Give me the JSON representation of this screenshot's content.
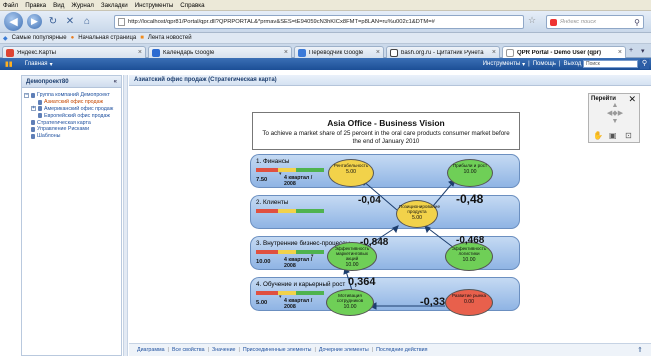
{
  "browser": {
    "menu": [
      "Файл",
      "Правка",
      "Вид",
      "Журнал",
      "Закладки",
      "Инструменты",
      "Справка"
    ],
    "url": "http://localhost/qpr81/Portal/qpr.dll?QPRPORTAL&*prmav&SES=tE94059cN3hKICx8FMT=p8LAN=ru%u002c1&DTM=#",
    "search_placeholder": "Яндекс поиск",
    "bookmarks": [
      "Самые популярные",
      "Начальная страница",
      "Лента новостей"
    ],
    "tabs": [
      {
        "label": "Яндекс.Карты",
        "color": "#d43"
      },
      {
        "label": "Календарь Google",
        "color": "#2c6bd1"
      },
      {
        "label": "Переводчик Google",
        "color": "#3b7ad8"
      },
      {
        "label": "bash.org.ru - Цитатник Рунета",
        "color": "#444"
      },
      {
        "label": "QPR Portal - Demo User (qpr)",
        "color": "#ccc"
      }
    ]
  },
  "app": {
    "home": "Главная",
    "tools": "Инструменты",
    "help": "Помощь",
    "logout": "Выход",
    "search": "Поиск"
  },
  "left_panel": {
    "title": "Демопроект80",
    "tree": [
      {
        "label": "Группа компаний Демопроект",
        "level": 0,
        "selected": false
      },
      {
        "label": "Азиатский офис продаж",
        "level": 2,
        "selected": true
      },
      {
        "label": "Американский офис продаж",
        "level": 1,
        "selected": false
      },
      {
        "label": "Европейский офис продаж",
        "level": 2,
        "selected": false
      },
      {
        "label": "Стратегическая карта",
        "level": 0,
        "selected": false
      },
      {
        "label": "Управление Рисками",
        "level": 0,
        "selected": false
      },
      {
        "label": "Шаблоны",
        "level": 0,
        "selected": false
      }
    ]
  },
  "main": {
    "title": "Азиатский офис продаж (Стратегическая карта)",
    "vision_title": "Asia Office - Business Vision",
    "vision_text": "To achieve a market share of 25 percent in the oral care products consumer market before the end of January 2010",
    "perspectives": [
      {
        "name": "1. Финансы",
        "value": "7.50",
        "period": "4 квартал / 2008"
      },
      {
        "name": "2. Клиенты",
        "value": "",
        "period": ""
      },
      {
        "name": "3. Внутренние бизнес-процессы",
        "value": "10.00",
        "period": "4 квартал / 2008"
      },
      {
        "name": "4. Обучение и карьерный рост",
        "value": "5.00",
        "period": "4 квартал / 2008"
      }
    ],
    "objectives": [
      {
        "name": "Рентабельность",
        "value": "5.00",
        "color": "#f2d24a"
      },
      {
        "name": "Прибыли и рост",
        "value": "10.00",
        "color": "#6fcf57"
      },
      {
        "name": "Позиционирование продукта",
        "value": "5.00",
        "color": "#f2d24a"
      },
      {
        "name": "Эффективность маркетинговых акций",
        "value": "10.00",
        "color": "#6fcf57"
      },
      {
        "name": "Эффективность логистики",
        "value": "10.00",
        "color": "#6fcf57"
      },
      {
        "name": "Мотивация сотрудников",
        "value": "10.00",
        "color": "#6fcf57"
      },
      {
        "name": "Развитие рынка",
        "value": "0.00",
        "color": "#e8604c"
      }
    ],
    "coefficients": [
      "-0,04",
      "-0,48",
      "-0,848",
      "-0,468",
      "0,364",
      "-0,33"
    ],
    "go_panel": {
      "title": "Перейти",
      "close": "✕"
    }
  },
  "footer": [
    "Диаграмма",
    "Все свойства",
    "Значение",
    "Присоединенные элементы",
    "Дочерние элементы",
    "Последние действия"
  ]
}
